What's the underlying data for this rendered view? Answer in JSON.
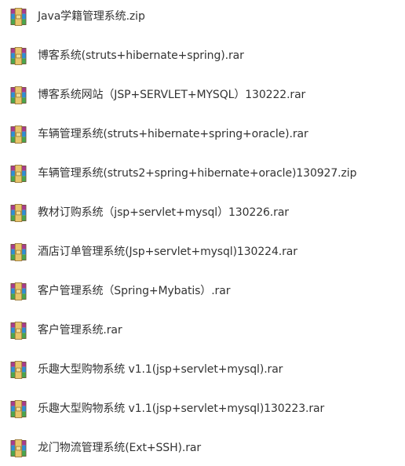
{
  "files": [
    {
      "name": "Java学籍管理系统.zip",
      "icon": "winrar-archive-icon"
    },
    {
      "name": "博客系统(struts+hibernate+spring).rar",
      "icon": "winrar-archive-icon"
    },
    {
      "name": "博客系统网站（JSP+SERVLET+MYSQL）130222.rar",
      "icon": "winrar-archive-icon"
    },
    {
      "name": "车辆管理系统(struts+hibernate+spring+oracle).rar",
      "icon": "winrar-archive-icon"
    },
    {
      "name": "车辆管理系统(struts2+spring+hibernate+oracle)130927.zip",
      "icon": "winrar-archive-icon"
    },
    {
      "name": "教材订购系统（jsp+servlet+mysql）130226.rar",
      "icon": "winrar-archive-icon"
    },
    {
      "name": "酒店订单管理系统(Jsp+servlet+mysql)130224.rar",
      "icon": "winrar-archive-icon"
    },
    {
      "name": "客户管理系统（Spring+Mybatis）.rar",
      "icon": "winrar-archive-icon"
    },
    {
      "name": "客户管理系统.rar",
      "icon": "winrar-archive-icon"
    },
    {
      "name": "乐趣大型购物系统 v1.1(jsp+servlet+mysql).rar",
      "icon": "winrar-archive-icon"
    },
    {
      "name": "乐趣大型购物系统 v1.1(jsp+servlet+mysql)130223.rar",
      "icon": "winrar-archive-icon"
    },
    {
      "name": "龙门物流管理系统(Ext+SSH).rar",
      "icon": "winrar-archive-icon"
    }
  ]
}
